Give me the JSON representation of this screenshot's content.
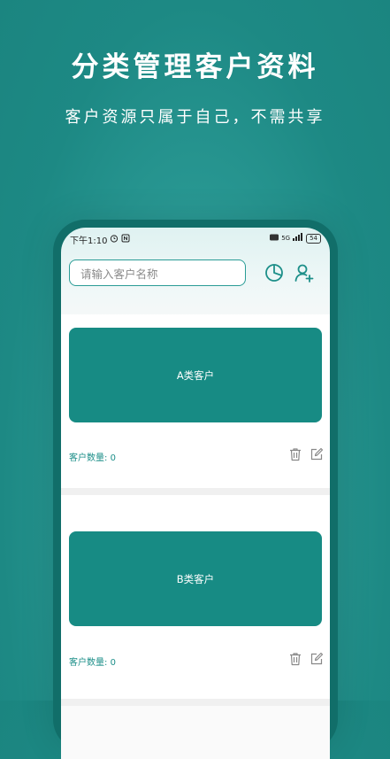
{
  "hero": {
    "title": "分类管理客户资料",
    "subtitle": "客户资源只属于自己，不需共享"
  },
  "status_bar": {
    "time": "下午1:10",
    "network": "5G",
    "battery": "54"
  },
  "search": {
    "placeholder": "请输入客户名称"
  },
  "icons": {
    "stats": "pie-chart-icon",
    "add_customer": "add-user-icon",
    "delete": "trash-icon",
    "edit": "edit-icon"
  },
  "categories": [
    {
      "label": "A类客户",
      "count_label": "客户数量: ",
      "count": "0"
    },
    {
      "label": "B类客户",
      "count_label": "客户数量: ",
      "count": "0"
    }
  ],
  "colors": {
    "accent": "#178b84",
    "background": "#2a9994",
    "count_text": "#1d8f89"
  }
}
